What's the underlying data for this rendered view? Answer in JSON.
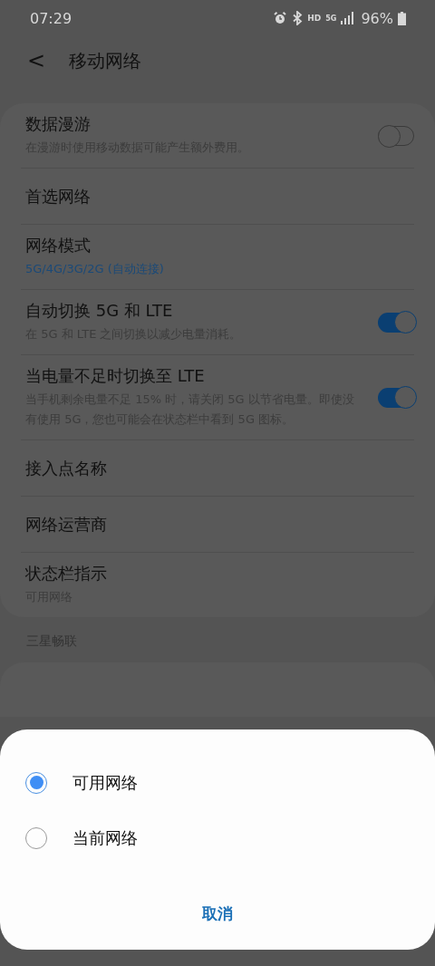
{
  "status_bar": {
    "time": "07:29",
    "hd": "HD",
    "network": "5G",
    "battery": "96%"
  },
  "header": {
    "back": "<",
    "title": "移动网络"
  },
  "settings": [
    {
      "kind": "toggle",
      "title": "数据漫游",
      "subtitle": "在漫游时使用移动数据可能产生额外费用。",
      "subtitle_accent": false,
      "on": false
    },
    {
      "kind": "plain",
      "title": "首选网络"
    },
    {
      "kind": "plain",
      "title": "网络模式",
      "subtitle": "5G/4G/3G/2G (自动连接)",
      "subtitle_accent": true
    },
    {
      "kind": "toggle",
      "title": "自动切换 5G 和 LTE",
      "subtitle": "在 5G 和 LTE 之间切换以减少电量消耗。",
      "subtitle_accent": false,
      "on": true
    },
    {
      "kind": "toggle",
      "title": "当电量不足时切换至 LTE",
      "subtitle": "当手机剩余电量不足 15% 时，请关闭 5G 以节省电量。即使没有使用 5G，您也可能会在状态栏中看到 5G 图标。",
      "subtitle_accent": false,
      "on": true
    },
    {
      "kind": "plain",
      "title": "接入点名称"
    },
    {
      "kind": "plain",
      "title": "网络运营商"
    },
    {
      "kind": "plain",
      "title": "状态栏指示",
      "subtitle": "可用网络",
      "subtitle_accent": false
    }
  ],
  "section_header": "三星畅联",
  "dialog": {
    "options": [
      {
        "label": "可用网络",
        "selected": true
      },
      {
        "label": "当前网络",
        "selected": false
      }
    ],
    "cancel": "取消"
  }
}
